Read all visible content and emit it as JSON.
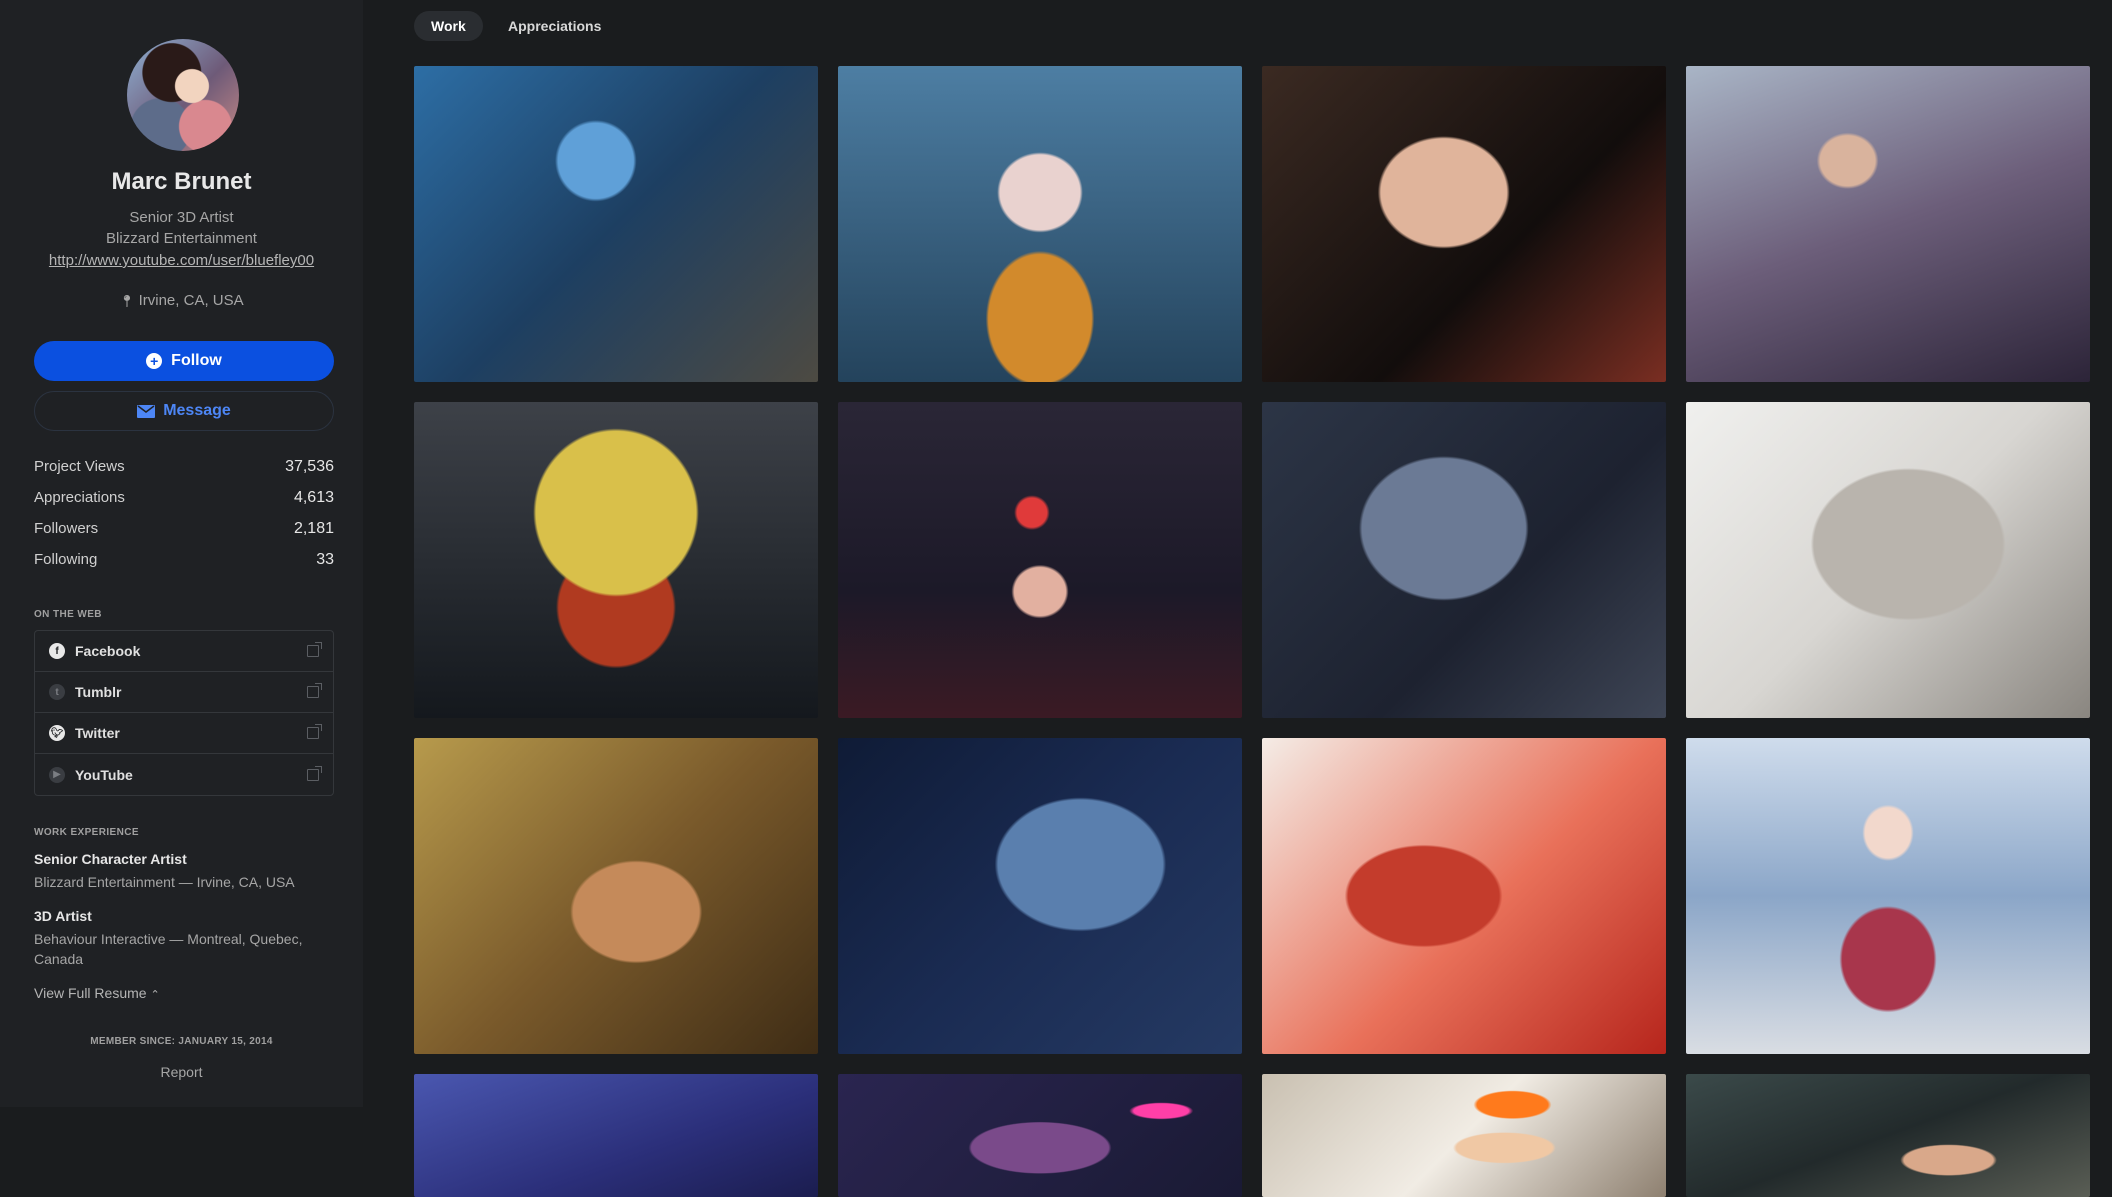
{
  "profile": {
    "name": "Marc Brunet",
    "title": "Senior 3D Artist",
    "company": "Blizzard Entertainment",
    "website": "http://www.youtube.com/user/bluefley00",
    "location": "Irvine, CA, USA"
  },
  "actions": {
    "follow_label": "Follow",
    "message_label": "Message"
  },
  "stats": [
    {
      "label": "Project Views",
      "value": "37,536"
    },
    {
      "label": "Appreciations",
      "value": "4,613"
    },
    {
      "label": "Followers",
      "value": "2,181"
    },
    {
      "label": "Following",
      "value": "33"
    }
  ],
  "on_the_web": {
    "heading": "ON THE WEB",
    "links": [
      {
        "label": "Facebook",
        "icon": "facebook-icon"
      },
      {
        "label": "Tumblr",
        "icon": "tumblr-icon"
      },
      {
        "label": "Twitter",
        "icon": "twitter-icon"
      },
      {
        "label": "YouTube",
        "icon": "youtube-icon"
      }
    ]
  },
  "work_experience": {
    "heading": "WORK EXPERIENCE",
    "jobs": [
      {
        "title": "Senior Character Artist",
        "desc": "Blizzard Entertainment — Irvine, CA, USA"
      },
      {
        "title": "3D Artist",
        "desc": "Behaviour Interactive — Montreal, Quebec, Canada"
      }
    ],
    "resume_label": "View Full Resume"
  },
  "member_since": "MEMBER SINCE: JANUARY 15, 2014",
  "report_label": "Report",
  "tabs": [
    {
      "label": "Work",
      "active": true
    },
    {
      "label": "Appreciations",
      "active": false
    }
  ],
  "projects_count": 16,
  "colors": {
    "background": "#1a1c1e",
    "sidebar": "#1f2124",
    "accent": "#0b50e0",
    "link_accent": "#4d86f5"
  }
}
